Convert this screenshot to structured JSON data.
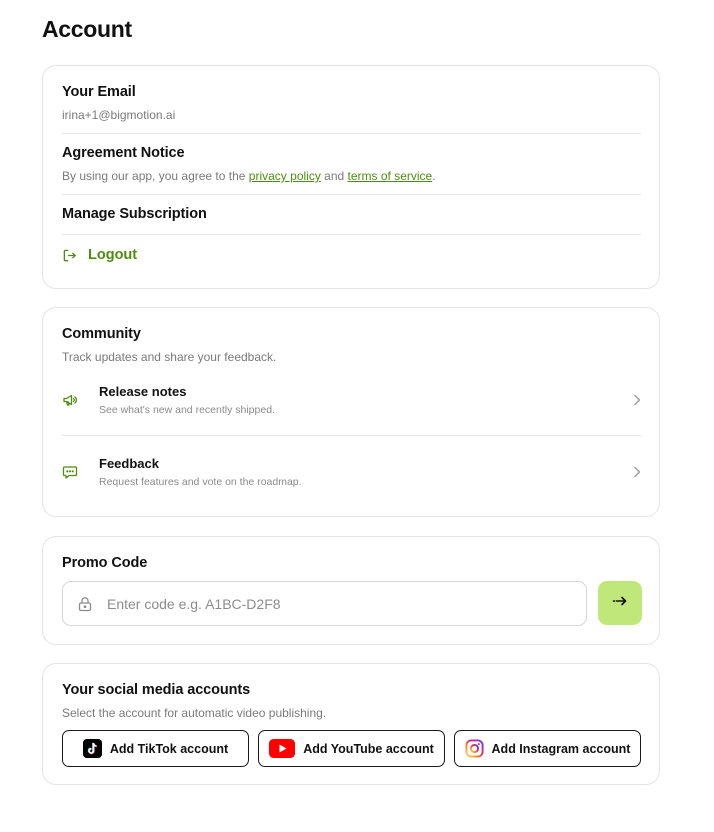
{
  "page": {
    "title": "Account"
  },
  "account": {
    "email_label": "Your Email",
    "email_value": "irina+1@bigmotion.ai",
    "agreement_label": "Agreement Notice",
    "agreement_text_before": "By using our app, you agree to the ",
    "privacy_link": "privacy policy",
    "agreement_text_middle": " and ",
    "terms_link": "terms of service",
    "agreement_text_after": ".",
    "manage_label": "Manage Subscription",
    "logout_label": "Logout",
    "logout_icon": "logout-icon"
  },
  "community": {
    "title": "Community",
    "subtitle": "Track updates and share your feedback.",
    "items": [
      {
        "title": "Release notes",
        "description": "See what's new and recently shipped.",
        "icon": "megaphone-icon"
      },
      {
        "title": "Feedback",
        "description": "Request features and vote on the roadmap.",
        "icon": "chat-icon"
      }
    ]
  },
  "promo": {
    "title": "Promo Code",
    "placeholder": "Enter code e.g. A1BC-D2F8",
    "value": "",
    "submit_icon": "arrow-right-icon"
  },
  "social": {
    "title": "Your social media accounts",
    "subtitle": "Select the account for automatic video publishing.",
    "buttons": [
      {
        "label": "Add TikTok account",
        "icon": "tiktok-icon"
      },
      {
        "label": "Add YouTube account",
        "icon": "youtube-icon"
      },
      {
        "label": "Add Instagram account",
        "icon": "instagram-icon"
      }
    ]
  },
  "colors": {
    "accent_green": "#4f8d12",
    "submit_bg": "#bfe779",
    "border": "#e4e4e4",
    "youtube_red": "#ff0000"
  }
}
